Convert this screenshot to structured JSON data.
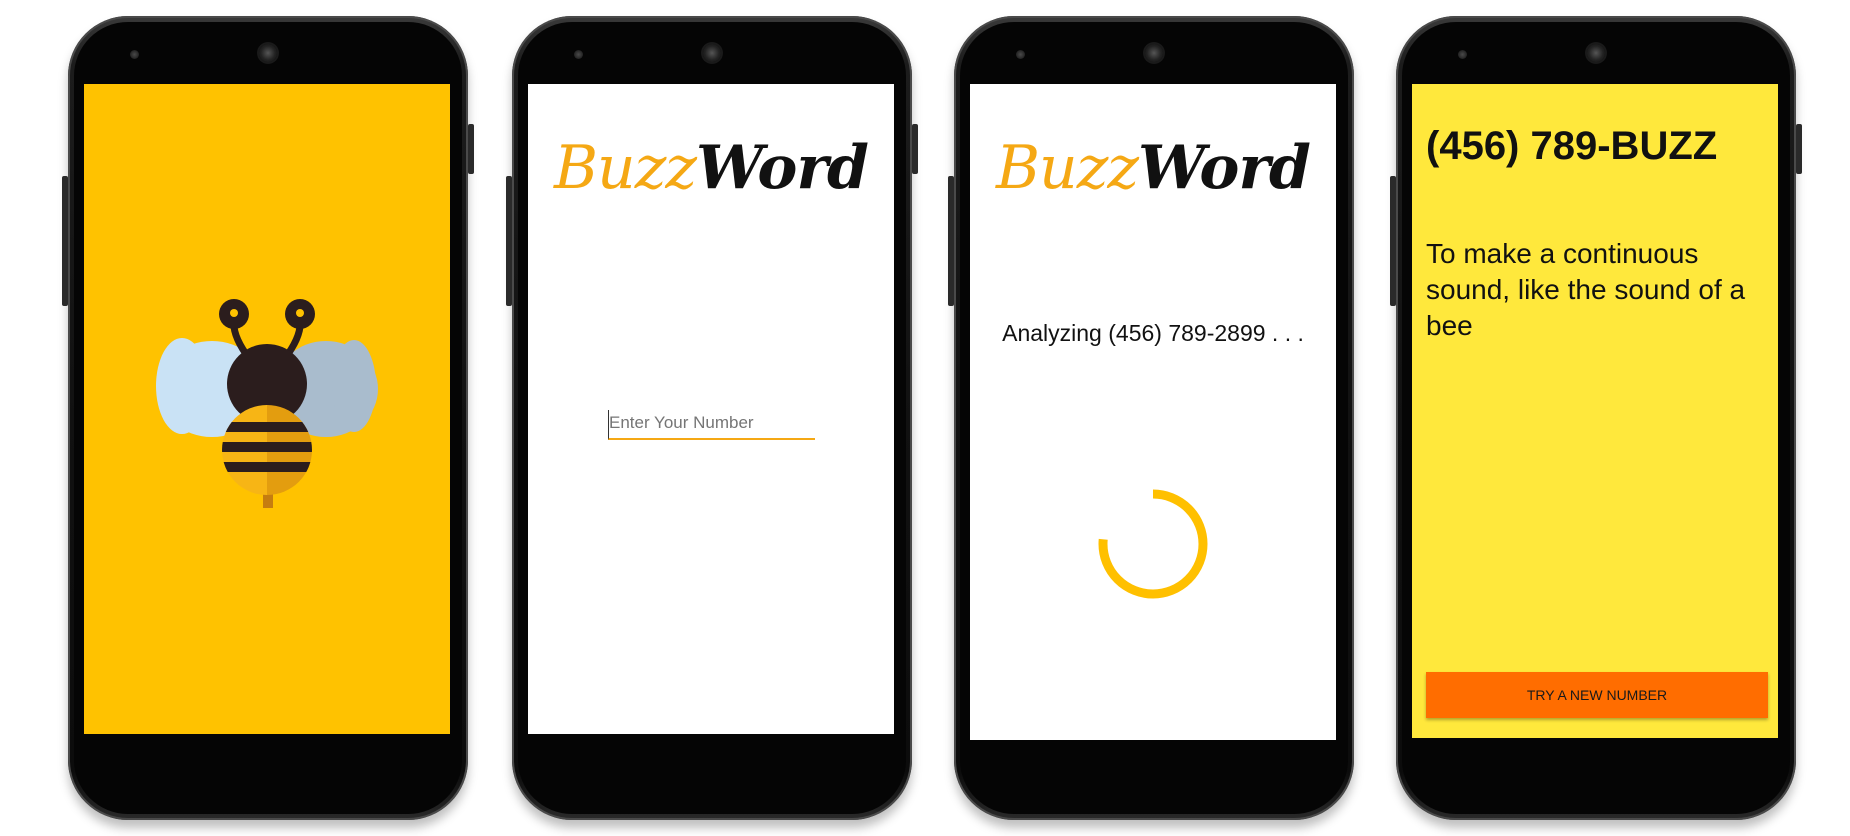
{
  "screens": [
    {
      "id": "splash",
      "background": "#ffc200",
      "logo_icon": "bee-icon"
    },
    {
      "id": "input",
      "background": "#ffffff",
      "logo": {
        "part1": "Buzz",
        "part2": "Word"
      },
      "input": {
        "placeholder": "Enter Your Number",
        "value": ""
      }
    },
    {
      "id": "loading",
      "background": "#ffffff",
      "logo": {
        "part1": "Buzz",
        "part2": "Word"
      },
      "status_text": "Analyzing (456) 789-2899 . . .",
      "spinner_icon": "loading-spinner-icon"
    },
    {
      "id": "result",
      "background": "#ffe83c",
      "title": "(456) 789-BUZZ",
      "definition": "To make a continuous sound, like the sound of a bee",
      "button_label": "TRY A NEW NUMBER"
    }
  ],
  "colors": {
    "accent_yellow": "#ffc200",
    "logo_orange": "#f5a814",
    "result_yellow": "#ffe83c",
    "button_orange": "#ff6d00"
  }
}
